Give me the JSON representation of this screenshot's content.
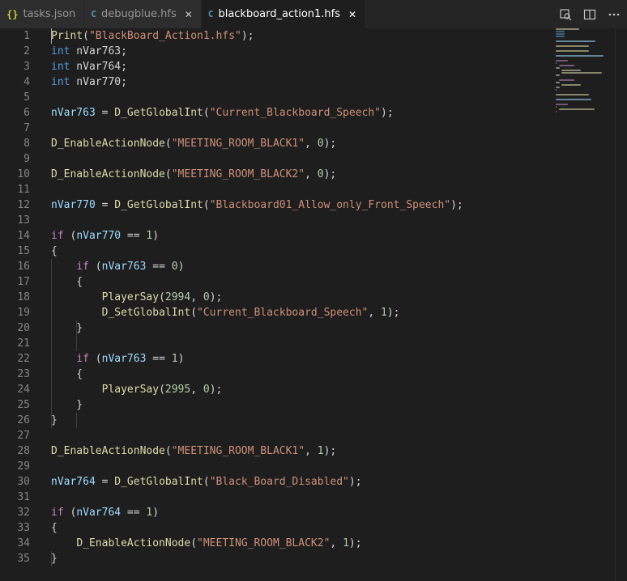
{
  "tabs": [
    {
      "icon": "json-file-icon",
      "glyph": "{}",
      "label": "tasks.json",
      "active": false,
      "closable": false
    },
    {
      "icon": "c-file-icon",
      "glyph": "C",
      "label": "debugblue.hfs",
      "active": false,
      "closable": true
    },
    {
      "icon": "c-file-icon",
      "glyph": "C",
      "label": "blackboard_action1.hfs",
      "active": true,
      "closable": true
    }
  ],
  "tab_actions": [
    "open-changes-icon",
    "split-editor-icon",
    "more-actions-icon"
  ],
  "colors": {
    "background": "#1e1e1e",
    "keyword": "#569cd6",
    "control": "#c586c0",
    "function": "#dcdcaa",
    "string": "#ce9178",
    "number": "#b5cea8",
    "variable": "#9cdcfe"
  },
  "code_lines": [
    {
      "n": "1",
      "tokens": [
        [
          "fn",
          "Print"
        ],
        [
          "pl",
          "("
        ],
        [
          "str",
          "\"BlackBoard_Action1.hfs\""
        ],
        [
          "pl",
          ");"
        ]
      ]
    },
    {
      "n": "2",
      "tokens": [
        [
          "kw",
          "int"
        ],
        [
          "pl",
          " nVar763;"
        ]
      ]
    },
    {
      "n": "3",
      "tokens": [
        [
          "kw",
          "int"
        ],
        [
          "pl",
          " nVar764;"
        ]
      ]
    },
    {
      "n": "4",
      "tokens": [
        [
          "kw",
          "int"
        ],
        [
          "pl",
          " nVar770;"
        ]
      ]
    },
    {
      "n": "5",
      "tokens": []
    },
    {
      "n": "6",
      "tokens": [
        [
          "var",
          "nVar763"
        ],
        [
          "pl",
          " = "
        ],
        [
          "fn",
          "D_GetGlobalInt"
        ],
        [
          "pl",
          "("
        ],
        [
          "str",
          "\"Current_Blackboard_Speech\""
        ],
        [
          "pl",
          ");"
        ]
      ]
    },
    {
      "n": "7",
      "tokens": []
    },
    {
      "n": "8",
      "tokens": [
        [
          "fn",
          "D_EnableActionNode"
        ],
        [
          "pl",
          "("
        ],
        [
          "str",
          "\"MEETING_ROOM_BLACK1\""
        ],
        [
          "pl",
          ", "
        ],
        [
          "num",
          "0"
        ],
        [
          "pl",
          ");"
        ]
      ]
    },
    {
      "n": "9",
      "tokens": []
    },
    {
      "n": "10",
      "tokens": [
        [
          "fn",
          "D_EnableActionNode"
        ],
        [
          "pl",
          "("
        ],
        [
          "str",
          "\"MEETING_ROOM_BLACK2\""
        ],
        [
          "pl",
          ", "
        ],
        [
          "num",
          "0"
        ],
        [
          "pl",
          ");"
        ]
      ]
    },
    {
      "n": "11",
      "tokens": []
    },
    {
      "n": "12",
      "tokens": [
        [
          "var",
          "nVar770"
        ],
        [
          "pl",
          " = "
        ],
        [
          "fn",
          "D_GetGlobalInt"
        ],
        [
          "pl",
          "("
        ],
        [
          "str",
          "\"Blackboard01_Allow_only_Front_Speech\""
        ],
        [
          "pl",
          ");"
        ]
      ]
    },
    {
      "n": "13",
      "tokens": []
    },
    {
      "n": "14",
      "tokens": [
        [
          "ctl",
          "if"
        ],
        [
          "pl",
          " ("
        ],
        [
          "var",
          "nVar770"
        ],
        [
          "pl",
          " == "
        ],
        [
          "num",
          "1"
        ],
        [
          "pl",
          ")"
        ]
      ]
    },
    {
      "n": "15",
      "tokens": [
        [
          "pl",
          "{"
        ]
      ]
    },
    {
      "n": "16",
      "tokens": [
        [
          "pl",
          "    "
        ],
        [
          "ctl",
          "if"
        ],
        [
          "pl",
          " ("
        ],
        [
          "var",
          "nVar763"
        ],
        [
          "pl",
          " == "
        ],
        [
          "num",
          "0"
        ],
        [
          "pl",
          ")"
        ]
      ]
    },
    {
      "n": "17",
      "tokens": [
        [
          "pl",
          "    {"
        ]
      ]
    },
    {
      "n": "18",
      "tokens": [
        [
          "pl",
          "        "
        ],
        [
          "fn",
          "PlayerSay"
        ],
        [
          "pl",
          "("
        ],
        [
          "num",
          "2994"
        ],
        [
          "pl",
          ", "
        ],
        [
          "num",
          "0"
        ],
        [
          "pl",
          ");"
        ]
      ]
    },
    {
      "n": "19",
      "tokens": [
        [
          "pl",
          "        "
        ],
        [
          "fn",
          "D_SetGlobalInt"
        ],
        [
          "pl",
          "("
        ],
        [
          "str",
          "\"Current_Blackboard_Speech\""
        ],
        [
          "pl",
          ", "
        ],
        [
          "num",
          "1"
        ],
        [
          "pl",
          ");"
        ]
      ]
    },
    {
      "n": "20",
      "tokens": [
        [
          "pl",
          "    }"
        ]
      ]
    },
    {
      "n": "21",
      "tokens": []
    },
    {
      "n": "22",
      "tokens": [
        [
          "pl",
          "    "
        ],
        [
          "ctl",
          "if"
        ],
        [
          "pl",
          " ("
        ],
        [
          "var",
          "nVar763"
        ],
        [
          "pl",
          " == "
        ],
        [
          "num",
          "1"
        ],
        [
          "pl",
          ")"
        ]
      ]
    },
    {
      "n": "23",
      "tokens": [
        [
          "pl",
          "    {"
        ]
      ]
    },
    {
      "n": "24",
      "tokens": [
        [
          "pl",
          "        "
        ],
        [
          "fn",
          "PlayerSay"
        ],
        [
          "pl",
          "("
        ],
        [
          "num",
          "2995"
        ],
        [
          "pl",
          ", "
        ],
        [
          "num",
          "0"
        ],
        [
          "pl",
          ");"
        ]
      ]
    },
    {
      "n": "25",
      "tokens": [
        [
          "pl",
          "    }"
        ]
      ]
    },
    {
      "n": "26",
      "tokens": [
        [
          "pl",
          "}"
        ]
      ]
    },
    {
      "n": "27",
      "tokens": []
    },
    {
      "n": "28",
      "tokens": [
        [
          "fn",
          "D_EnableActionNode"
        ],
        [
          "pl",
          "("
        ],
        [
          "str",
          "\"MEETING_ROOM_BLACK1\""
        ],
        [
          "pl",
          ", "
        ],
        [
          "num",
          "1"
        ],
        [
          "pl",
          ");"
        ]
      ]
    },
    {
      "n": "29",
      "tokens": []
    },
    {
      "n": "30",
      "tokens": [
        [
          "var",
          "nVar764"
        ],
        [
          "pl",
          " = "
        ],
        [
          "fn",
          "D_GetGlobalInt"
        ],
        [
          "pl",
          "("
        ],
        [
          "str",
          "\"Black_Board_Disabled\""
        ],
        [
          "pl",
          ");"
        ]
      ]
    },
    {
      "n": "31",
      "tokens": []
    },
    {
      "n": "32",
      "tokens": [
        [
          "ctl",
          "if"
        ],
        [
          "pl",
          " ("
        ],
        [
          "var",
          "nVar764"
        ],
        [
          "pl",
          " == "
        ],
        [
          "num",
          "1"
        ],
        [
          "pl",
          ")"
        ]
      ]
    },
    {
      "n": "33",
      "tokens": [
        [
          "pl",
          "{"
        ]
      ]
    },
    {
      "n": "34",
      "tokens": [
        [
          "pl",
          "    "
        ],
        [
          "fn",
          "D_EnableActionNode"
        ],
        [
          "pl",
          "("
        ],
        [
          "str",
          "\"MEETING_ROOM_BLACK2\""
        ],
        [
          "pl",
          ", "
        ],
        [
          "num",
          "1"
        ],
        [
          "pl",
          ");"
        ]
      ]
    },
    {
      "n": "35",
      "tokens": [
        [
          "pl",
          "}"
        ]
      ]
    }
  ]
}
